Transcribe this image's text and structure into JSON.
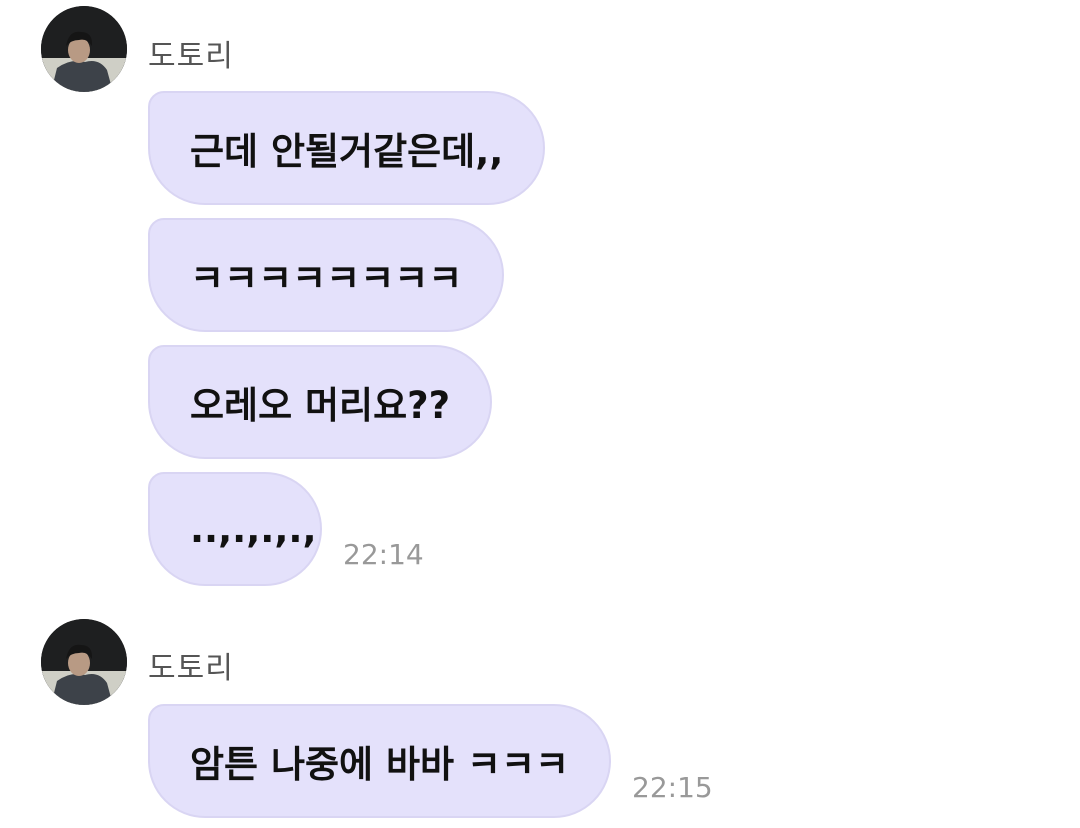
{
  "groups": [
    {
      "sender": "도토리",
      "messages": [
        {
          "text": "근데 안될거같은데,,"
        },
        {
          "text": "ㅋㅋㅋㅋㅋㅋㅋㅋ"
        },
        {
          "text": "오레오 머리요??"
        },
        {
          "text": "..,.,.,.,"
        }
      ],
      "time": "22:14"
    },
    {
      "sender": "도토리",
      "messages": [
        {
          "text": "암튼 나중에 바바 ㅋㅋㅋ"
        }
      ],
      "time": "22:15"
    }
  ],
  "colors": {
    "bubble": "#e4e1fb",
    "bubble_border": "#d9d5f3",
    "sender_text": "#555555",
    "time_text": "#999999",
    "message_text": "#111111"
  },
  "icons": {
    "avatar": "profile-photo"
  }
}
